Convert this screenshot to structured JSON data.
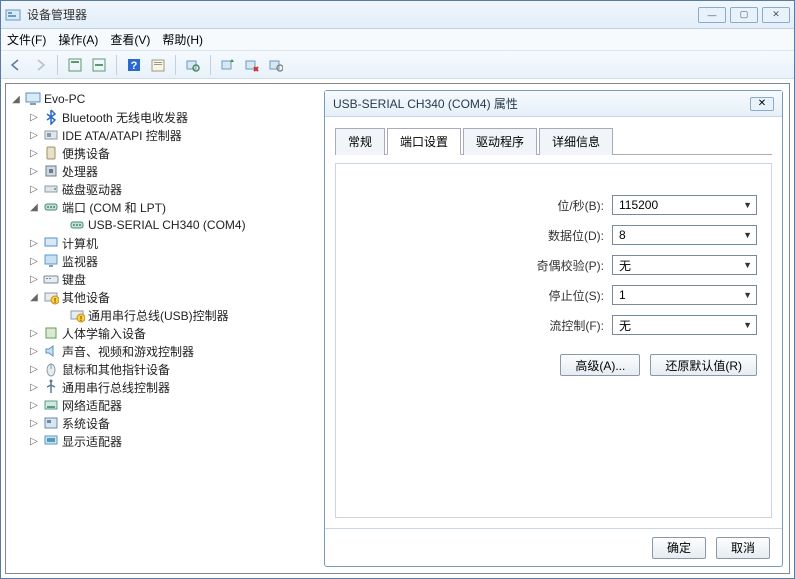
{
  "window": {
    "title": "设备管理器"
  },
  "menu": {
    "file": "文件(F)",
    "action": "操作(A)",
    "view": "查看(V)",
    "help": "帮助(H)"
  },
  "tree": {
    "root": "Evo-PC",
    "n_bluetooth": "Bluetooth 无线电收发器",
    "n_ide": "IDE ATA/ATAPI 控制器",
    "n_portable": "便携设备",
    "n_cpu": "处理器",
    "n_disk": "磁盘驱动器",
    "n_ports": "端口 (COM 和 LPT)",
    "n_ports_child": "USB-SERIAL CH340 (COM4)",
    "n_computer": "计算机",
    "n_monitor": "监视器",
    "n_keyboard": "键盘",
    "n_other": "其他设备",
    "n_other_child": "通用串行总线(USB)控制器",
    "n_hid": "人体学输入设备",
    "n_sound": "声音、视频和游戏控制器",
    "n_mouse": "鼠标和其他指针设备",
    "n_usb": "通用串行总线控制器",
    "n_network": "网络适配器",
    "n_system": "系统设备",
    "n_display": "显示适配器"
  },
  "dialog": {
    "title": "USB-SERIAL CH340 (COM4) 属性",
    "tabs": {
      "general": "常规",
      "port": "端口设置",
      "driver": "驱动程序",
      "detail": "详细信息"
    },
    "fields": {
      "baud_label": "位/秒(B):",
      "baud_val": "115200",
      "databits_label": "数据位(D):",
      "databits_val": "8",
      "parity_label": "奇偶校验(P):",
      "parity_val": "无",
      "stopbits_label": "停止位(S):",
      "stopbits_val": "1",
      "flow_label": "流控制(F):",
      "flow_val": "无"
    },
    "advanced_btn": "高级(A)...",
    "restore_btn": "还原默认值(R)",
    "ok_btn": "确定",
    "cancel_btn": "取消"
  },
  "icons": {
    "pc": "#5a8fc8",
    "bt": "#2a6ad0",
    "hdd": "#8a9aa8",
    "cpu": "#6a7a8a",
    "drive": "#8a9aa8",
    "port": "#4a8a7a",
    "mon": "#5a9ad0",
    "kb": "#7a8a9a",
    "warn": "#e0b020",
    "hid": "#6a9a5a",
    "snd": "#5a8fc8",
    "mouse": "#8a9aa8",
    "usb": "#5a7a9a",
    "net": "#5a9a8a",
    "sys": "#6a8aa8",
    "disp": "#5a9ab8"
  }
}
